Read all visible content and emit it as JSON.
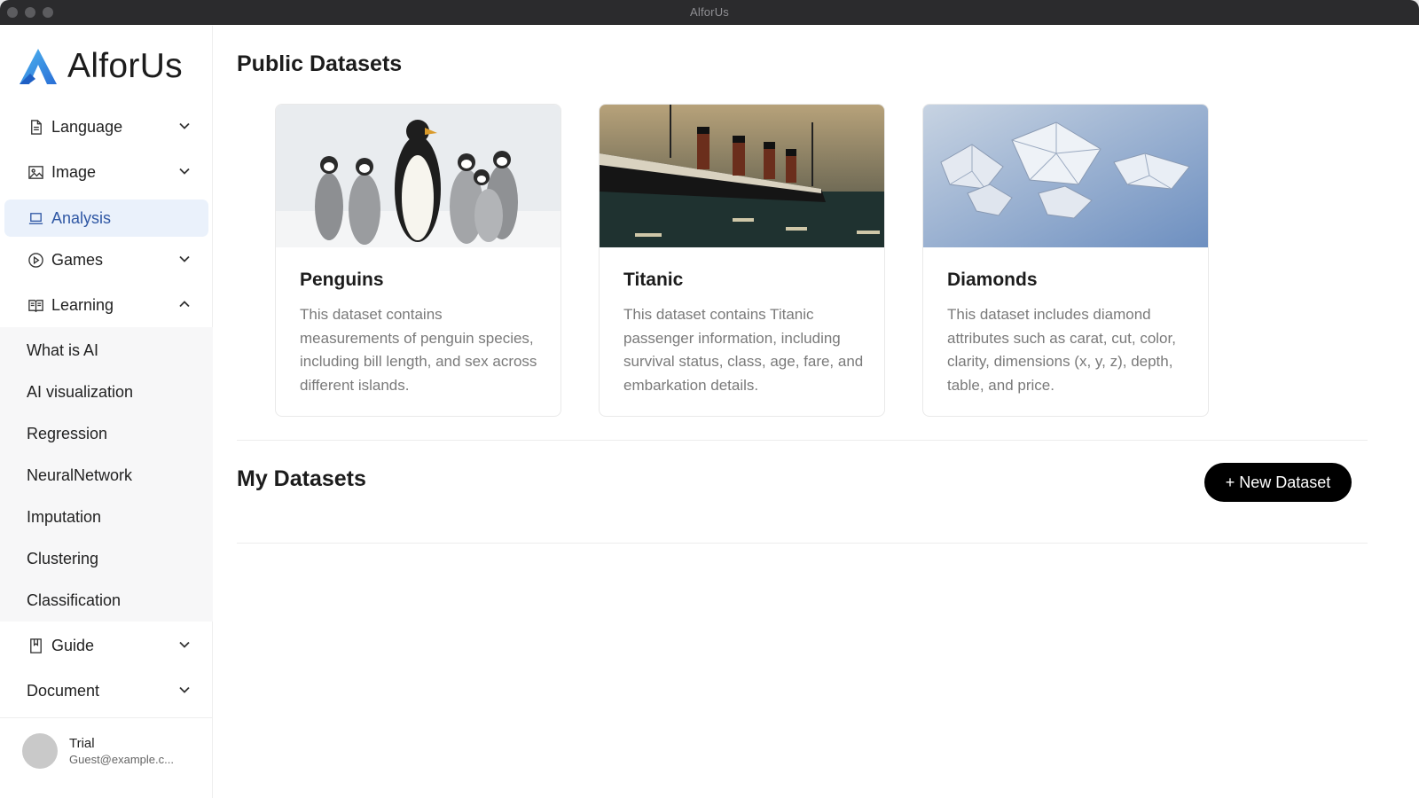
{
  "window": {
    "title": "AlforUs"
  },
  "sidebar": {
    "logo_text": "AlforUs",
    "items": [
      {
        "label": "Language",
        "icon": "document-icon",
        "expanded": false
      },
      {
        "label": "Image",
        "icon": "image-icon",
        "expanded": false
      },
      {
        "label": "Analysis",
        "icon": "laptop-icon",
        "active": true
      },
      {
        "label": "Games",
        "icon": "play-circle-icon",
        "expanded": false
      },
      {
        "label": "Learning",
        "icon": "book-open-icon",
        "expanded": true
      },
      {
        "label": "Guide",
        "icon": "notebook-icon",
        "expanded": false
      },
      {
        "label": "Document",
        "expanded": false
      }
    ],
    "learning_subitems": [
      "What is AI",
      "AI visualization",
      "Regression",
      "NeuralNetwork",
      "Imputation",
      "Clustering",
      "Classification"
    ],
    "user": {
      "name": "Trial",
      "email": "Guest@example.c..."
    }
  },
  "main": {
    "public_title": "Public Datasets",
    "cards": [
      {
        "title": "Penguins",
        "description": "This dataset contains measurements of penguin species, including bill length, and sex across different islands."
      },
      {
        "title": "Titanic",
        "description": "This dataset contains Titanic passenger information, including survival status, class, age, fare, and embarkation details."
      },
      {
        "title": "Diamonds",
        "description": "This dataset includes diamond attributes such as carat, cut, color, clarity, dimensions (x, y, z), depth, table, and price."
      }
    ],
    "my_title": "My Datasets",
    "new_button": "+ New Dataset"
  },
  "colors": {
    "accent": "#2f57a4",
    "active_bg": "#eaf1fb",
    "button_bg": "#000000"
  }
}
